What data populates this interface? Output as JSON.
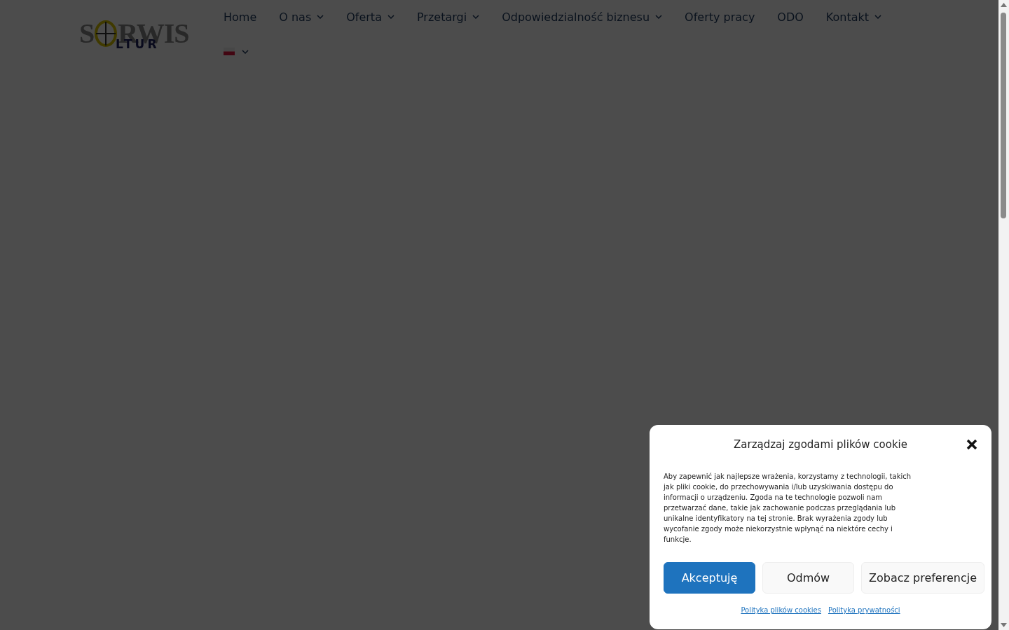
{
  "logo": {
    "left": "S",
    "right": "RWIS",
    "sub": "LTUR"
  },
  "nav": [
    {
      "label": "Home",
      "dropdown": false
    },
    {
      "label": "O nas",
      "dropdown": true
    },
    {
      "label": "Oferta",
      "dropdown": true
    },
    {
      "label": "Przetargi",
      "dropdown": true
    },
    {
      "label": "Odpowiedzialność biznesu",
      "dropdown": true
    },
    {
      "label": "Oferty pracy",
      "dropdown": false
    },
    {
      "label": "ODO",
      "dropdown": false
    },
    {
      "label": "Kontakt",
      "dropdown": true
    }
  ],
  "language": {
    "dropdown": true
  },
  "cookie_banner": {
    "title": "Zarządzaj zgodami plików cookie",
    "text": "Aby zapewnić jak najlepsze wrażenia, korzystamy z technologii, takich jak pliki cookie, do przechowywania i/lub uzyskiwania dostępu do informacji o urządzeniu. Zgoda na te technologie pozwoli nam przetwarzać dane, takie jak zachowanie podczas przeglądania lub unikalne identyfikatory na tej stronie. Brak wyrażenia zgody lub wycofanie zgody może niekorzystnie wpłynąć na niektóre cechy i funkcje.",
    "buttons": [
      {
        "label": "Akceptuję",
        "kind": "primary"
      },
      {
        "label": "Odmów",
        "kind": "secondary"
      },
      {
        "label": "Zobacz preferencje",
        "kind": "secondary"
      }
    ],
    "links": [
      "Polityka plików cookies",
      "Polityka prywatności"
    ]
  }
}
